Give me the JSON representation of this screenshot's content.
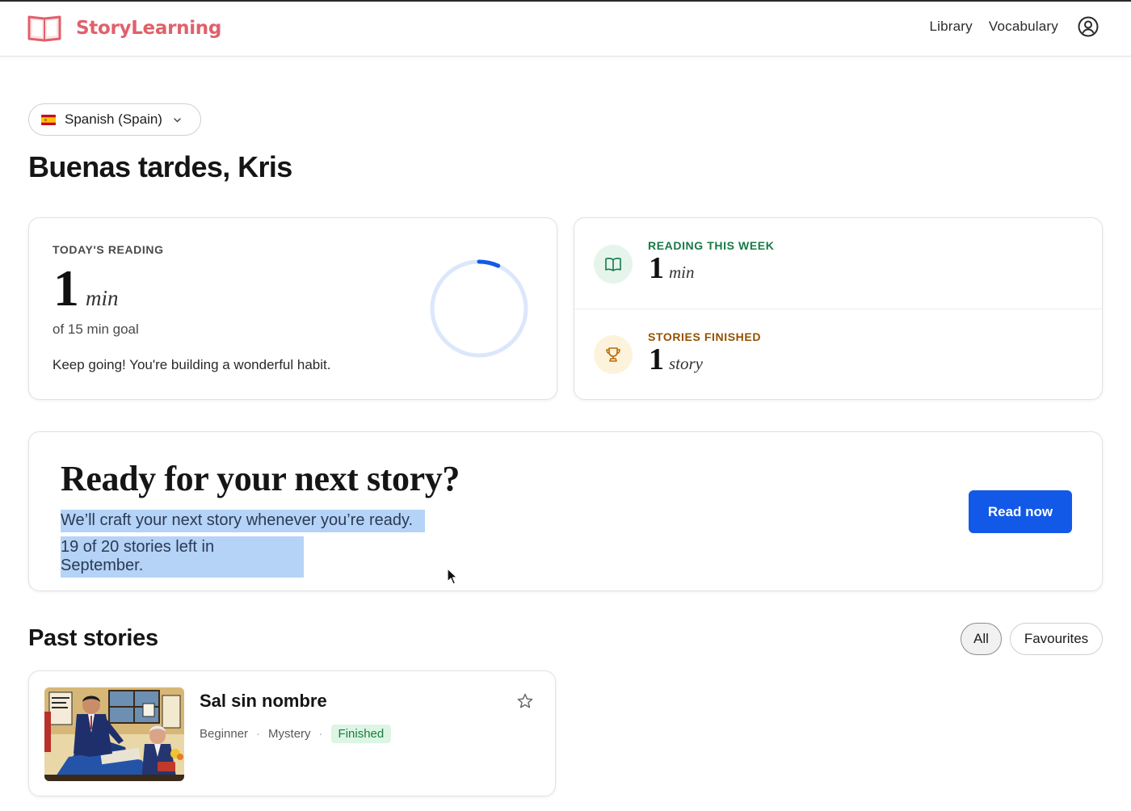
{
  "app": {
    "brand": "StoryLearning"
  },
  "nav": {
    "links": [
      "Library",
      "Vocabulary"
    ],
    "user_icon": "user-circle-icon"
  },
  "language": {
    "selected": "Spanish (Spain)",
    "flag_icon": "spain-flag-icon"
  },
  "greeting": "Buenas tardes, Kris",
  "today": {
    "eyebrow": "TODAY'S READING",
    "value": "1",
    "unit": "min",
    "goal_text": "of 15 min goal",
    "message": "Keep going! You're building a wonderful habit.",
    "progress_fraction": 0.067
  },
  "week": {
    "eyebrow": "READING THIS WEEK",
    "value": "1",
    "unit": "min",
    "icon": "open-book-icon"
  },
  "finished": {
    "eyebrow": "STORIES FINISHED",
    "value": "1",
    "unit": "story",
    "icon": "trophy-icon"
  },
  "next_story": {
    "title": "Ready for your next story?",
    "line1": "We’ll craft your next story whenever you’re ready.",
    "line2": "19 of 20 stories left in September.",
    "button": "Read now"
  },
  "past": {
    "title": "Past stories",
    "filters": [
      "All",
      "Favourites"
    ],
    "active_filter": "All",
    "stories": [
      {
        "title": "Sal sin nombre",
        "level": "Beginner",
        "genre": "Mystery",
        "status": "Finished",
        "favourite": false
      }
    ]
  },
  "colors": {
    "brand": "#e0606a",
    "accent": "#1259e8",
    "week_green": "#177a45",
    "finished_amber": "#955000",
    "selection": "#b4d3f6"
  }
}
